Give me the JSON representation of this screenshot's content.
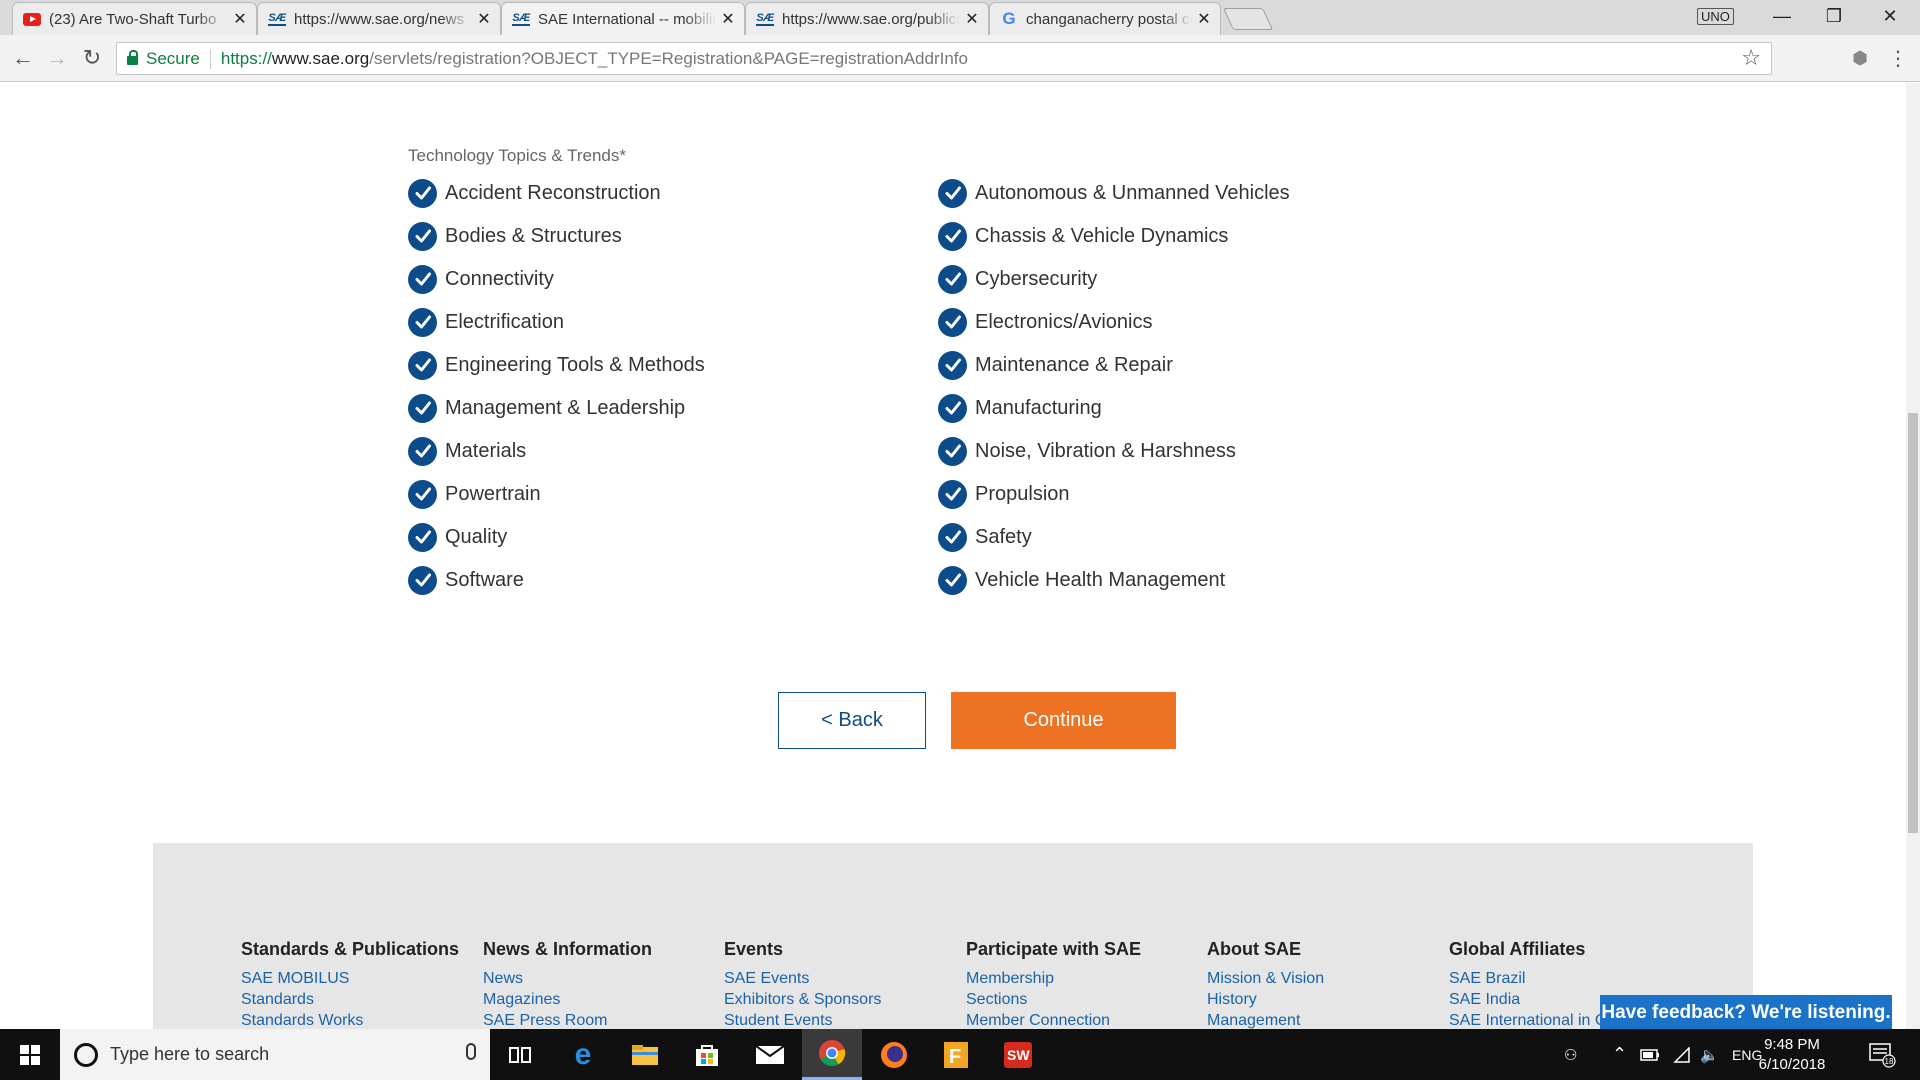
{
  "browser": {
    "tabs": [
      {
        "favicon": "youtube-icon",
        "title": "(23) Are Two-Shaft Turbo",
        "active": false
      },
      {
        "favicon": "sae-icon",
        "title": "https://www.sae.org/news",
        "active": false
      },
      {
        "favicon": "sae-icon",
        "title": "SAE International -- mobility",
        "active": true
      },
      {
        "favicon": "sae-icon",
        "title": "https://www.sae.org/publications",
        "active": false
      },
      {
        "favicon": "google-icon",
        "title": "changanacherry postal code",
        "active": false
      }
    ],
    "profile_label": "UNO",
    "secure_label": "Secure",
    "url": {
      "proto": "https://",
      "host": "www.sae.org",
      "path": "/servlets/registration?OBJECT_TYPE=Registration&PAGE=registrationAddrInfo"
    }
  },
  "form": {
    "section_label": "Technology Topics & Trends*",
    "topics_left": [
      "Accident Reconstruction",
      "Bodies & Structures",
      "Connectivity",
      "Electrification",
      "Engineering Tools & Methods",
      "Management & Leadership",
      "Materials",
      "Powertrain",
      "Quality",
      "Software"
    ],
    "topics_right": [
      "Autonomous & Unmanned Vehicles",
      "Chassis & Vehicle Dynamics",
      "Cybersecurity",
      "Electronics/Avionics",
      "Maintenance & Repair",
      "Manufacturing",
      "Noise, Vibration & Harshness",
      "Propulsion",
      "Safety",
      "Vehicle Health Management"
    ],
    "back_label": "< Back",
    "continue_label": "Continue"
  },
  "footer": {
    "columns": [
      {
        "heading": "Standards & Publications",
        "links": [
          "SAE MOBILUS",
          "Standards",
          "Standards Works"
        ]
      },
      {
        "heading": "News & Information",
        "links": [
          "News",
          "Magazines",
          "SAE Press Room"
        ]
      },
      {
        "heading": "Events",
        "links": [
          "SAE Events",
          "Exhibitors & Sponsors",
          "Student Events"
        ]
      },
      {
        "heading": "Participate with SAE",
        "links": [
          "Membership",
          "Sections",
          "Member Connection"
        ]
      },
      {
        "heading": "About SAE",
        "links": [
          "Mission & Vision",
          "History",
          "Management"
        ]
      },
      {
        "heading": "Global Affiliates",
        "links": [
          "SAE Brazil",
          "SAE India",
          "SAE International in China"
        ]
      }
    ],
    "feedback_label": "Have feedback? We're listening."
  },
  "taskbar": {
    "search_placeholder": "Type here to search",
    "apps": [
      "task-view-icon",
      "edge-icon",
      "file-explorer-icon",
      "store-icon",
      "mail-icon",
      "chrome-icon",
      "firefox-icon",
      "app-f-icon",
      "solidworks-icon"
    ],
    "language": "ENG",
    "time": "9:48 PM",
    "date": "6/10/2018",
    "notification_count": "18"
  },
  "colors": {
    "brand_blue": "#0d4c8a",
    "continue_orange": "#ee7224",
    "link_blue": "#1a63a8",
    "secure_green": "#0b8043"
  }
}
